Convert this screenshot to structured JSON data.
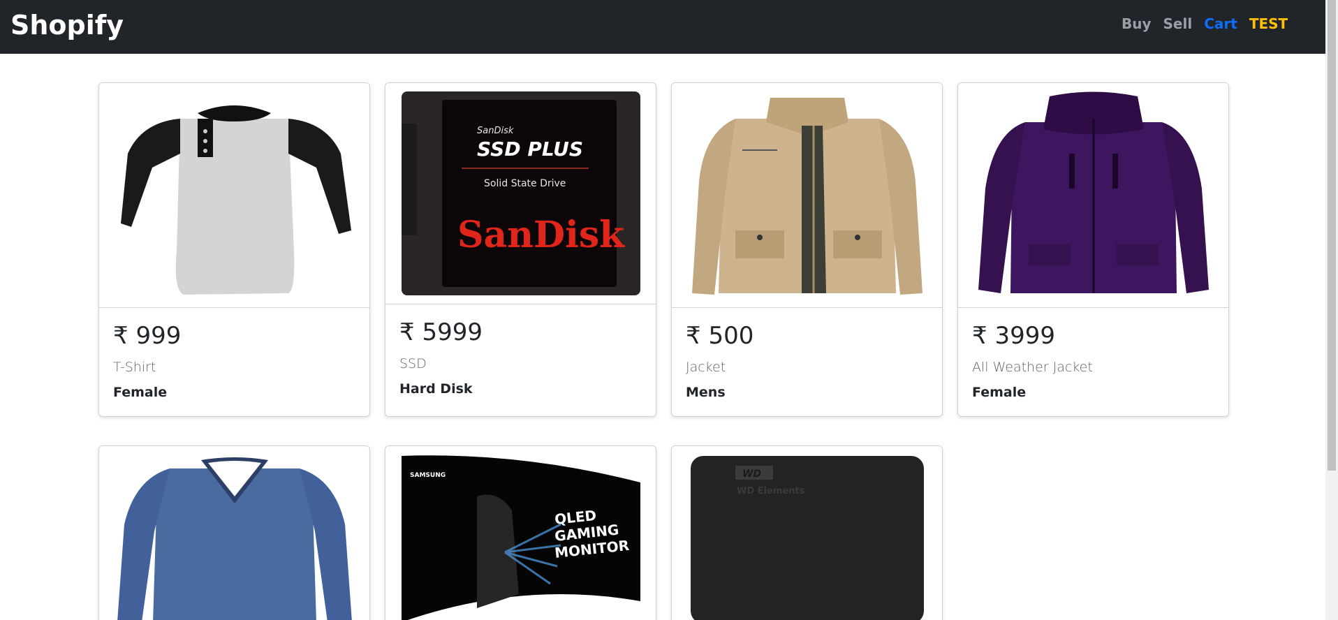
{
  "nav": {
    "brand": "Shopify",
    "links": [
      {
        "label": "Buy",
        "color": "#9aa0a6"
      },
      {
        "label": "Sell",
        "color": "#9aa0a6"
      },
      {
        "label": "Cart",
        "color": "#0d6efd"
      },
      {
        "label": "TEST",
        "color": "#ffc107"
      }
    ]
  },
  "products": [
    {
      "price": "₹ 999",
      "title": "T-Shirt",
      "category": "Female",
      "image": "raglan-tshirt-icon"
    },
    {
      "price": "₹ 5999",
      "title": "SSD",
      "category": "Hard Disk",
      "image": "sandisk-ssd-icon",
      "image_text": {
        "brand_small": "SanDisk",
        "product": "SSD PLUS",
        "sub": "Solid State Drive",
        "brand_logo": "SanDisk"
      }
    },
    {
      "price": "₹ 500",
      "title": "Jacket",
      "category": "Mens",
      "image": "khaki-jacket-icon"
    },
    {
      "price": "₹ 3999",
      "title": "All Weather Jacket",
      "category": "Female",
      "image": "purple-jacket-icon"
    },
    {
      "price": "",
      "title": "",
      "category": "",
      "image": "blue-vneck-tshirt-icon"
    },
    {
      "price": "",
      "title": "",
      "category": "",
      "image": "curved-monitor-icon",
      "image_text": {
        "brand": "SAMSUNG",
        "line1": "QLED",
        "line2": "GAMING",
        "line3": "MONITOR"
      }
    },
    {
      "price": "",
      "title": "",
      "category": "",
      "image": "external-hdd-icon",
      "image_text": {
        "brand": "WD",
        "product": "WD Elements"
      }
    }
  ]
}
